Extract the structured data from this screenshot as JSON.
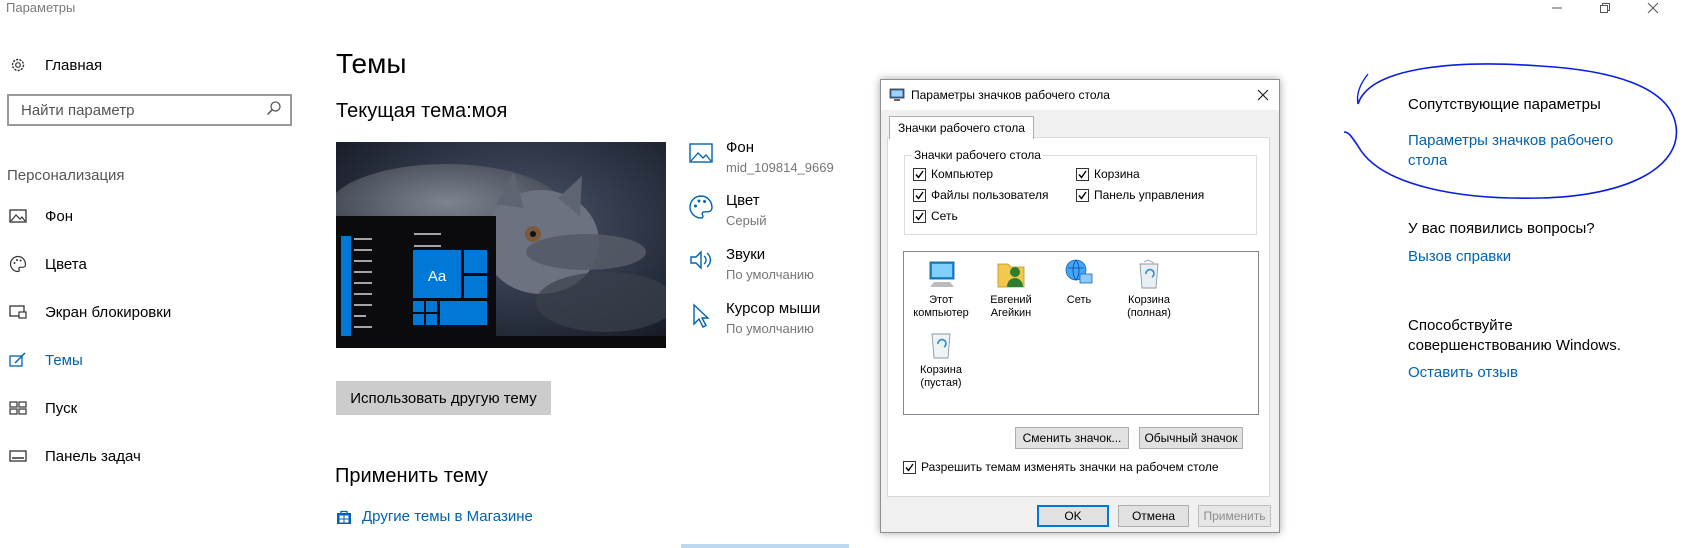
{
  "window": {
    "title": "Параметры"
  },
  "sidebar": {
    "home_label": "Главная",
    "search_placeholder": "Найти параметр",
    "section_label": "Персонализация",
    "items": [
      {
        "label": "Фон",
        "icon": "image-icon"
      },
      {
        "label": "Цвета",
        "icon": "palette-icon"
      },
      {
        "label": "Экран блокировки",
        "icon": "lock-screen-icon"
      },
      {
        "label": "Темы",
        "icon": "themes-icon",
        "active": true
      },
      {
        "label": "Пуск",
        "icon": "start-icon"
      },
      {
        "label": "Панель задач",
        "icon": "taskbar-icon"
      }
    ]
  },
  "main": {
    "title": "Темы",
    "current_theme": "Текущая тема:моя",
    "preview_sample_text": "Aa",
    "attributes": [
      {
        "title": "Фон",
        "value": "mid_109814_9669",
        "icon": "image-icon"
      },
      {
        "title": "Цвет",
        "value": "Серый",
        "icon": "palette-icon"
      },
      {
        "title": "Звуки",
        "value": "По умолчанию",
        "icon": "speaker-icon"
      },
      {
        "title": "Курсор мыши",
        "value": "По умолчанию",
        "icon": "cursor-icon"
      }
    ],
    "use_other_theme_button": "Использовать другую тему",
    "apply_theme_heading": "Применить тему",
    "store_link": "Другие темы в Магазине"
  },
  "right_pane": {
    "related_heading": "Сопутствующие параметры",
    "related_link": "Параметры значков рабочего стола",
    "questions_heading": "У вас появились вопросы?",
    "help_link": "Вызов справки",
    "improve_text": "Способствуйте совершенствованию Windows.",
    "feedback_link": "Оставить отзыв",
    "annotation_color": "#0a1ee0"
  },
  "dialog": {
    "title": "Параметры значков рабочего стола",
    "tab": "Значки рабочего стола",
    "group_label": "Значки рабочего стола",
    "checkboxes": [
      {
        "label": "Компьютер",
        "checked": true
      },
      {
        "label": "Корзина",
        "checked": true
      },
      {
        "label": "Файлы пользователя",
        "checked": true
      },
      {
        "label": "Панель управления",
        "checked": true
      },
      {
        "label": "Сеть",
        "checked": true
      }
    ],
    "icons": [
      {
        "label": "Этот компьютер",
        "icon": "computer-icon"
      },
      {
        "label": "Евгений Агейкин",
        "icon": "user-folder-icon"
      },
      {
        "label": "Сеть",
        "icon": "network-icon"
      },
      {
        "label": "Корзина (полная)",
        "icon": "recycle-bin-full-icon"
      },
      {
        "label": "Корзина (пустая)",
        "icon": "recycle-bin-empty-icon"
      }
    ],
    "change_icon_button": "Сменить значок...",
    "default_icon_button": "Обычный значок",
    "allow_themes_checkbox": "Разрешить темам изменять значки на рабочем столе",
    "allow_themes_checked": true,
    "ok_button": "OK",
    "cancel_button": "Отмена",
    "apply_button": "Применить"
  },
  "colors": {
    "accent": "#0063b1",
    "tile_blue": "#0078d7",
    "preview_bg": "#1f2533"
  }
}
